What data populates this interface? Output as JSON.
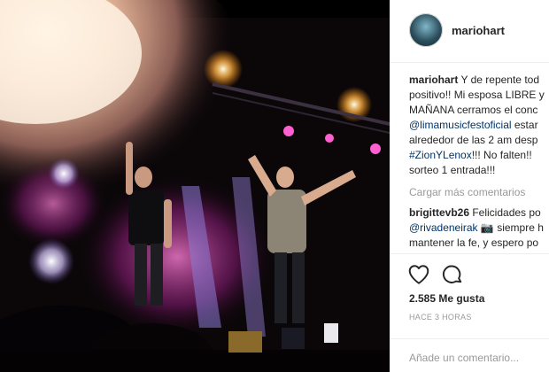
{
  "post": {
    "username": "mariohart",
    "caption_lines": [
      {
        "user": "mariohart",
        "text": " Y de repente tod"
      },
      {
        "text": "positivo!! Mi esposa LIBRE y"
      },
      {
        "text": "MAÑANA cerramos el conc"
      },
      {
        "link": "@limamusicfestoficial",
        "text": " estar"
      },
      {
        "text": "alrededor de las 2 am desp"
      },
      {
        "link": "#ZionYLenox",
        "text": "!!! No falten!!"
      },
      {
        "text": "sorteo 1 entrada!!!"
      }
    ],
    "load_more": "Cargar más comentarios",
    "comment": {
      "user": "brigittevb26",
      "line1_text": " Felicidades po",
      "line2_link": "@rivadeneirak",
      "line2_emoji": "📷",
      "line2_text": " siempre h",
      "line3_text": "mantener la fe, y espero po"
    },
    "likes": "2.585 Me gusta",
    "time": "HACE 3 HORAS",
    "add_comment_placeholder": "Añade un comentario..."
  },
  "icons": [
    "heart-icon",
    "comment-icon"
  ],
  "colors": {
    "link": "#003569",
    "muted": "#999999",
    "text": "#262626"
  }
}
